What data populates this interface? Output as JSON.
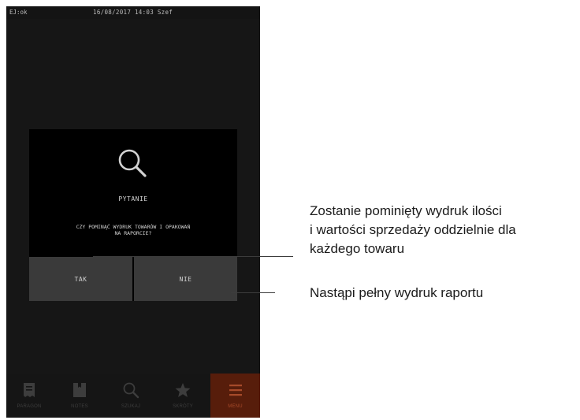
{
  "statusbar": {
    "left": "EJ:ok",
    "center": "16/08/2017 14:03 Szef"
  },
  "dialog": {
    "icon": "magnifier-icon",
    "title": "PYTANIE",
    "question_line1": "CZY POMINĄĆ WYDRUK TOWARÓW I OPAKOWAŃ",
    "question_line2": "NA RAPORCIE?",
    "yes_label": "TAK",
    "no_label": "NIE"
  },
  "nav": {
    "items": [
      {
        "label": "PARAGON",
        "icon": "receipt-icon"
      },
      {
        "label": "NOTES",
        "icon": "notes-icon"
      },
      {
        "label": "SZUKAJ",
        "icon": "search-icon"
      },
      {
        "label": "SKRÓTY",
        "icon": "star-icon"
      },
      {
        "label": "MENU",
        "icon": "menu-icon",
        "active": true
      }
    ]
  },
  "annotations": {
    "yes_line1": "Zostanie pominięty wydruk ilości",
    "yes_line2": "i wartości sprzedaży oddzielnie dla",
    "yes_line3": "każdego towaru",
    "no_line1": "Nastąpi pełny wydruk raportu"
  },
  "colors": {
    "screen_bg": "#1e1e1e",
    "dialog_bg": "#000000",
    "button_bg": "#3a3a3a",
    "menu_active": "#571d0b"
  }
}
